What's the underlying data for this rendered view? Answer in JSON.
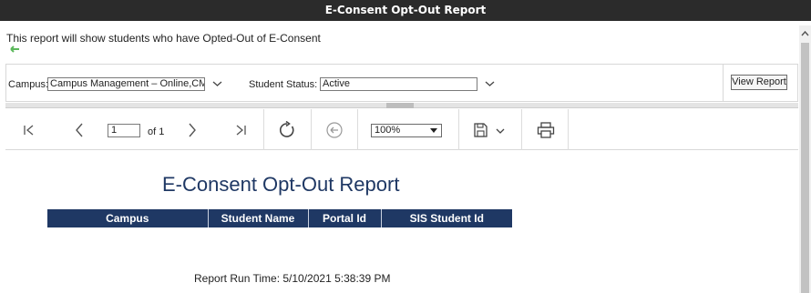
{
  "window": {
    "title": "E-Consent Opt-Out Report"
  },
  "description": "This report will show students who have Opted-Out of E-Consent",
  "params": {
    "campus_label": "Campus:",
    "campus_value": "Campus Management – Online,CM",
    "status_label": "Student Status:",
    "status_value": "Active",
    "view_report_label": "View Report"
  },
  "toolbar": {
    "page_value": "1",
    "page_of": "of 1",
    "zoom_value": "100%"
  },
  "report": {
    "title": "E-Consent Opt-Out Report",
    "columns": [
      "Campus",
      "Student Name",
      "Portal Id",
      "SIS Student Id"
    ],
    "run_time": "Report Run Time: 5/10/2021 5:38:39 PM"
  },
  "colors": {
    "titlebar": "#2b2b2b",
    "header": "#1f3864",
    "back_arrow": "#5cb85c"
  },
  "icons": [
    "back-arrow-icon",
    "chevron-down-icon",
    "first-page-icon",
    "previous-page-icon",
    "next-page-icon",
    "last-page-icon",
    "refresh-icon",
    "back-circle-icon",
    "save-icon",
    "print-icon"
  ]
}
